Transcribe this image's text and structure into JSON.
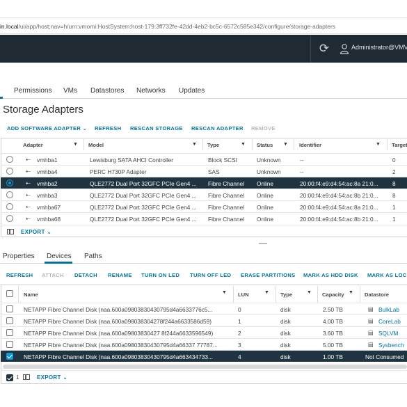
{
  "browser": {
    "url_prefix": "in.local",
    "url_rest": "/ui/app/host;nav=h/urn:vmomi:HostSystem:host-179:3ff732fe-42dd-4eb2-bc5c-6572c585e342/configure/storage-adapters"
  },
  "header": {
    "user": "Administrator@VMV",
    "icons": [
      "refresh-icon",
      "user-icon"
    ]
  },
  "host_tabs": [
    "Permissions",
    "VMs",
    "Datastores",
    "Networks",
    "Updates"
  ],
  "page_title": "Storage Adapters",
  "adapter_actions": [
    "ADD SOFTWARE ADAPTER ⌄",
    "REFRESH",
    "RESCAN STORAGE",
    "RESCAN ADAPTER",
    "REMOVE"
  ],
  "adapter_columns": [
    "Adapter",
    "Model",
    "Type",
    "Status",
    "Identifier",
    "Targets"
  ],
  "adapters": [
    {
      "adapter": "vmhba1",
      "model": "Lewisburg SATA AHCI Controller",
      "type": "Block SCSI",
      "status": "Unknown",
      "identifier": "--",
      "targets": "0"
    },
    {
      "adapter": "vmhba4",
      "model": "PERC H730P Adapter",
      "type": "SAS",
      "status": "Unknown",
      "identifier": "--",
      "targets": "2"
    },
    {
      "adapter": "vmhba2",
      "model": "QLE2772 Dual Port 32GFC PCIe Gen4 ...",
      "type": "Fibre Channel",
      "status": "Online",
      "identifier": "20:00:f4:e9:d4:54:ac:8a 21:0...",
      "targets": "8"
    },
    {
      "adapter": "vmhba3",
      "model": "QLE2772 Dual Port 32GFC PCIe Gen4 ...",
      "type": "Fibre Channel",
      "status": "Online",
      "identifier": "20:00:f4:e9:d4:54:ac:8b 21:0...",
      "targets": "8"
    },
    {
      "adapter": "vmhba67",
      "model": "QLE2772 Dual Port 32GFC PCIe Gen4 ...",
      "type": "Fibre Channel",
      "status": "Online",
      "identifier": "20:00:f4:e9:d4:54:ac:8a 21:0...",
      "targets": "1"
    },
    {
      "adapter": "vmhba68",
      "model": "QLE2772 Dual Port 32GFC PCIe Gen4 ...",
      "type": "Fibre Channel",
      "status": "Online",
      "identifier": "20:00:f4:e9:d4:54:ac:8b 21:0...",
      "targets": "1"
    }
  ],
  "adapter_footer": {
    "export": "EXPORT ⌄"
  },
  "detail_tabs": [
    "Properties",
    "Devices",
    "Paths"
  ],
  "device_actions": [
    "REFRESH",
    "ATTACH",
    "DETACH",
    "RENAME",
    "TURN ON LED",
    "TURN OFF LED",
    "ERASE PARTITIONS",
    "MARK AS HDD DISK",
    "MARK AS LOCA"
  ],
  "device_columns": [
    "Name",
    "LUN",
    "Type",
    "Capacity",
    "Datastore"
  ],
  "devices": [
    {
      "name": "NETAPP Fibre Channel Disk (naa.600a09803830430795d4a6633776c5...",
      "lun": "0",
      "type": "disk",
      "capacity": "2.50 TB",
      "datastore": "BulkLab"
    },
    {
      "name": "NETAPP Fibre Channel Disk (naa.600a098038304278f244a6633586d59)",
      "lun": "1",
      "type": "disk",
      "capacity": "4.00 TB",
      "datastore": "CoreLab"
    },
    {
      "name": "NETAPP Fibre Channel Disk (naa.600a09803830427 8f244a6633596549)",
      "lun": "2",
      "type": "disk",
      "capacity": "3.60 TB",
      "datastore": "SQLVM"
    },
    {
      "name": "NETAPP Fibre Channel Disk (naa.600a09803830430795d4a66337 77787...",
      "lun": "3",
      "type": "disk",
      "capacity": "5.00 TB",
      "datastore": "Sysbench"
    },
    {
      "name": "NETAPP Fibre Channel Disk (naa.600a09803830430795d4a663434733...",
      "lun": "4",
      "type": "disk",
      "capacity": "1.00 TB",
      "datastore": "Not Consumed"
    }
  ],
  "device_footer": {
    "selected_count": "1",
    "export": "EXPORT ⌄"
  }
}
